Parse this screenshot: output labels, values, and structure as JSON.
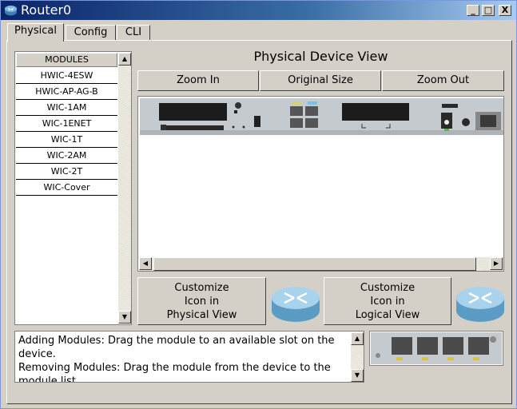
{
  "window": {
    "title": "Router0",
    "minimize_label": "_",
    "maximize_label": "□",
    "close_label": "X"
  },
  "tabs": [
    {
      "label": "Physical"
    },
    {
      "label": "Config"
    },
    {
      "label": "CLI"
    }
  ],
  "modules": {
    "header": "MODULES",
    "items": [
      "HWIC-4ESW",
      "HWIC-AP-AG-B",
      "WIC-1AM",
      "WIC-1ENET",
      "WIC-1T",
      "WIC-2AM",
      "WIC-2T",
      "WIC-Cover"
    ]
  },
  "device_view": {
    "title": "Physical Device View",
    "zoom_in": "Zoom In",
    "original_size": "Original Size",
    "zoom_out": "Zoom Out"
  },
  "customize": {
    "physical": "Customize\nIcon in\nPhysical View",
    "logical": "Customize\nIcon in\nLogical View"
  },
  "help": {
    "adding": "Adding Modules: Drag the module to an available slot on the device.",
    "removing": "Removing Modules: Drag the module from the device to the module list."
  },
  "colors": {
    "titlebar_start": "#0a246a",
    "window_bg": "#d4d0c8"
  }
}
